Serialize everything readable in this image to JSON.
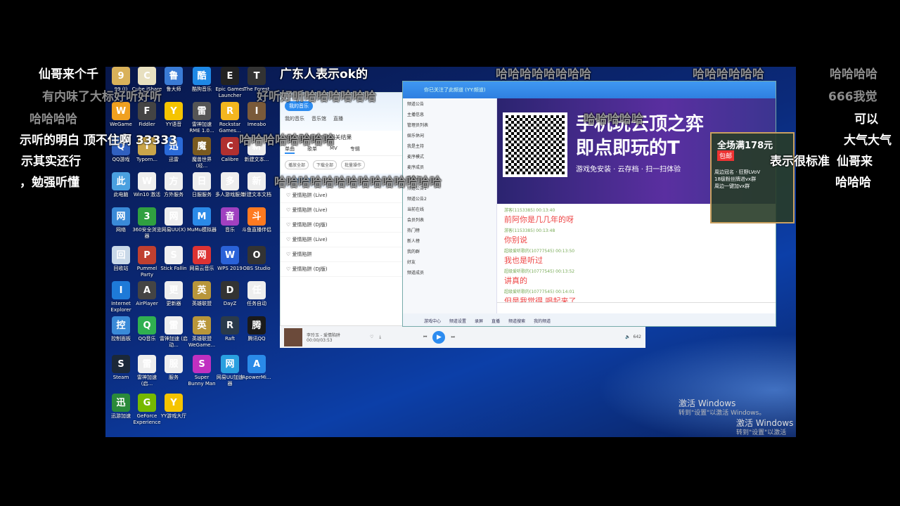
{
  "desktop_icons": [
    {
      "label": "99 (I)",
      "icon": "folder-icon",
      "color": "#d9b15a"
    },
    {
      "label": "Cube iShare V5...",
      "icon": "cube-icon",
      "color": "#e8e0c0"
    },
    {
      "label": "鲁大师",
      "icon": "ludashi-icon",
      "color": "#3a7bd5"
    },
    {
      "label": "酷狗音乐",
      "icon": "kugou-icon",
      "color": "#1e88e5"
    },
    {
      "label": "Epic Games Launcher",
      "icon": "epic-icon",
      "color": "#222"
    },
    {
      "label": "The Forest",
      "icon": "forest-icon",
      "color": "#333"
    },
    {
      "label": "WeGame",
      "icon": "wegame-icon",
      "color": "#f0a020"
    },
    {
      "label": "Fiddler",
      "icon": "fiddler-icon",
      "color": "#444"
    },
    {
      "label": "YY语音",
      "icon": "yy-icon",
      "color": "#f5c400"
    },
    {
      "label": "雷神加速 RME 1.0...",
      "icon": "app-icon",
      "color": "#555"
    },
    {
      "label": "Rockstar Games...",
      "icon": "rockstar-icon",
      "color": "#f3b61f"
    },
    {
      "label": "Imeabo",
      "icon": "avatar-icon",
      "color": "#7a5a3a"
    },
    {
      "label": "QQ游戏",
      "icon": "qqgame-icon",
      "color": "#3060c0"
    },
    {
      "label": "Typorn...",
      "icon": "app-icon",
      "color": "#c9a54a"
    },
    {
      "label": "迅雷",
      "icon": "xunlei-icon",
      "color": "#2a6ad8"
    },
    {
      "label": "魔兽世界 (经...",
      "icon": "wow-icon",
      "color": "#7a5a20"
    },
    {
      "label": "Calibre",
      "icon": "calibre-icon",
      "color": "#b03030"
    },
    {
      "label": "新建文本...",
      "icon": "file-icon",
      "color": "#eeeeee"
    },
    {
      "label": "此电脑",
      "icon": "computer-icon",
      "color": "#4aa0e0"
    },
    {
      "label": "Win10 激活",
      "icon": "file-icon",
      "color": "#eeeeee"
    },
    {
      "label": "方外服务",
      "icon": "file-icon",
      "color": "#eeeeee"
    },
    {
      "label": "日服服务",
      "icon": "file-icon",
      "color": "#eeeeee"
    },
    {
      "label": "多人游戏服务",
      "icon": "file-icon",
      "color": "#eeeeee"
    },
    {
      "label": "新建文本文档",
      "icon": "file-icon",
      "color": "#eeeeee"
    },
    {
      "label": "网络",
      "icon": "network-icon",
      "color": "#3a8ad8"
    },
    {
      "label": "360安全浏览器",
      "icon": "browser360-icon",
      "color": "#30a040"
    },
    {
      "label": "网易UU(X)",
      "icon": "file-icon",
      "color": "#eeeeee"
    },
    {
      "label": "MuMu模拟器",
      "icon": "mumu-icon",
      "color": "#2a8ae8"
    },
    {
      "label": "音乐",
      "icon": "music-icon",
      "color": "#a040c0"
    },
    {
      "label": "斗鱼直播伴侣",
      "icon": "douyu-icon",
      "color": "#ff7a20"
    },
    {
      "label": "回收站",
      "icon": "recycle-bin-icon",
      "color": "#c8d8e8"
    },
    {
      "label": "Pummel Party",
      "icon": "pummel-icon",
      "color": "#c04030"
    },
    {
      "label": "Stick Fallin",
      "icon": "stick-icon",
      "color": "#f0f0f0"
    },
    {
      "label": "网易云音乐",
      "icon": "netease-music-icon",
      "color": "#d33"
    },
    {
      "label": "WPS 2019",
      "icon": "wps-icon",
      "color": "#2a62d8"
    },
    {
      "label": "OBS Studio",
      "icon": "obs-icon",
      "color": "#333"
    },
    {
      "label": "Internet Explorer",
      "icon": "ie-icon",
      "color": "#1e7ad8"
    },
    {
      "label": "AirPlayer",
      "icon": "airplay-icon",
      "color": "#444"
    },
    {
      "label": "更新器",
      "icon": "file-icon",
      "color": "#eeeeee"
    },
    {
      "label": "英雄联盟",
      "icon": "lol-icon",
      "color": "#b8963a"
    },
    {
      "label": "DayZ",
      "icon": "dayz-icon",
      "color": "#333"
    },
    {
      "label": "任务自动",
      "icon": "file-icon",
      "color": "#eeeeee"
    },
    {
      "label": "控制面板",
      "icon": "control-panel-icon",
      "color": "#3a8ad8"
    },
    {
      "label": "QQ音乐",
      "icon": "qqmusic-icon",
      "color": "#30b050"
    },
    {
      "label": "雷神加速 (启动...",
      "icon": "file-icon",
      "color": "#eeeeee"
    },
    {
      "label": "英雄联盟 WeGame...",
      "icon": "lol-icon",
      "color": "#b8963a"
    },
    {
      "label": "Raft",
      "icon": "raft-icon",
      "color": "#2a3a4a"
    },
    {
      "label": "腾讯QQ",
      "icon": "qq-icon",
      "color": "#1a1a1a"
    },
    {
      "label": "Steam",
      "icon": "steam-icon",
      "color": "#1b2838"
    },
    {
      "label": "雷神加速 (启...",
      "icon": "file-icon",
      "color": "#eeeeee"
    },
    {
      "label": "服务",
      "icon": "file-icon",
      "color": "#eeeeee"
    },
    {
      "label": "Super Bunny Man",
      "icon": "bunny-icon",
      "color": "#c030c0"
    },
    {
      "label": "网易UU加速器",
      "icon": "uu-icon",
      "color": "#2aa0e0"
    },
    {
      "label": "ApowerMi...",
      "icon": "apower-icon",
      "color": "#2a8ae8"
    },
    {
      "label": "迅游加速",
      "icon": "xunyou-icon",
      "color": "#2a8a3a"
    },
    {
      "label": "GeForce Experience",
      "icon": "nvidia-icon",
      "color": "#76b900"
    },
    {
      "label": "YY游戏大厅",
      "icon": "yygame-icon",
      "color": "#f5c400"
    }
  ],
  "activation": {
    "line1": "激活 Windows",
    "line2": "转到\"设置\"以激活 Windows。",
    "line3": "激活 Windows",
    "line4": "转到\"设置\"以激活 Windows"
  },
  "music_app": {
    "user_button": "我的音乐",
    "tabs": [
      "我的音乐",
      "音乐馆",
      "直播"
    ],
    "search_title": "搜索\"爱情陷阱\"的相关结果",
    "result_tabs": [
      "单曲",
      "歌单",
      "MV",
      "专辑"
    ],
    "actions": [
      "播放全部",
      "下载全部",
      "批量操作"
    ],
    "songs": [
      "爱情陷阱",
      "爱情陷阱 (Live)",
      "爱情陷阱 (Live)",
      "爱情陷阱 (DJ版)",
      "爱情陷阱 (Live)",
      "爱情陷阱",
      "爱情陷阱 (DJ版)"
    ],
    "player": {
      "now_playing": "李玲玉 - 爱情陷阱",
      "time": "00:00/03:53",
      "volume": "642"
    }
  },
  "yy_window": {
    "title": "你已关注了此频道 (YY:频道)",
    "channel_list": [
      "频道公告",
      "主播信息",
      "管理员列表",
      "娱乐休闲",
      "我是主持",
      "麦序模式",
      "麦序成员",
      "排麦中",
      "频道公告1",
      "频道公告2",
      "当前在线",
      "会员列表",
      "热门榜",
      "新人榜",
      "我的群",
      "好友",
      "频道成员"
    ],
    "banner_title_1": "手机玩云顶之弈",
    "banner_title_2": "即点即玩的T",
    "banner_subtitle": "游戏免安装 · 云存档 · 扫一扫体验",
    "chat": [
      {
        "meta": "游客(1153385) 00:13:40",
        "text": "前阿你是几几年的呀"
      },
      {
        "meta": "游客(1153385) 00:13:48",
        "text": "你别说"
      },
      {
        "meta": "超级爱听歌的(10777545) 00:13:50",
        "text": "我也是听过"
      },
      {
        "meta": "超级爱听歌的(10777545) 00:13:52",
        "text": "讲真的"
      },
      {
        "meta": "超级爱听歌的(10777545) 00:14:01",
        "text": "但是我觉得 唱起来了"
      },
      {
        "meta": "游客(1153385) 00:14:01",
        "text": "陈思阿唱的这首歌是我听过他唱的最好的一首歌"
      }
    ],
    "toolbar": [
      "游戏中心",
      "频道设置",
      "录屏",
      "直播",
      "频道搜索",
      "我的频道"
    ]
  },
  "promo": {
    "line1": "全场满178元",
    "line2": "包邮",
    "line3": "周边冠名 · 狂野LVoV",
    "line4": "18级粉丝牌进vx群",
    "line5": "周边一键加vx群"
  },
  "danmaku": [
    {
      "text": "仙哥来个千",
      "style": "cn"
    },
    {
      "text": "广东人表示ok的",
      "style": "cn"
    },
    {
      "text": "哈哈哈哈哈哈哈哈",
      "style": "gray"
    },
    {
      "text": "哈哈哈哈哈哈",
      "style": "gray"
    },
    {
      "text": "哈哈哈哈",
      "style": "gray"
    },
    {
      "text": "有内味了大标好听好听",
      "style": "gray"
    },
    {
      "text": "好听好听哈哈哈哈哈哈",
      "style": "gray"
    },
    {
      "text": "666我觉",
      "style": "gray"
    },
    {
      "text": "哈哈哈哈",
      "style": "gray"
    },
    {
      "text": "哈哈哈哈哈",
      "style": "gray"
    },
    {
      "text": "可以",
      "style": "cn"
    },
    {
      "text": "示听的明白 顶不住啊 33333",
      "style": "cn"
    },
    {
      "text": "哈哈哈哈哈哈哈哈",
      "style": "gray"
    },
    {
      "text": "大气大气",
      "style": "cn"
    },
    {
      "text": "示其实还行",
      "style": "cn"
    },
    {
      "text": "表示很标准",
      "style": "cn"
    },
    {
      "text": "仙哥来",
      "style": "cn"
    },
    {
      "text": "，勉强听懂",
      "style": "cn"
    },
    {
      "text": "哈哈哈哈哈哈哈哈哈哈哈哈哈哈",
      "style": "gray"
    },
    {
      "text": "哈哈哈",
      "style": "cn"
    }
  ]
}
